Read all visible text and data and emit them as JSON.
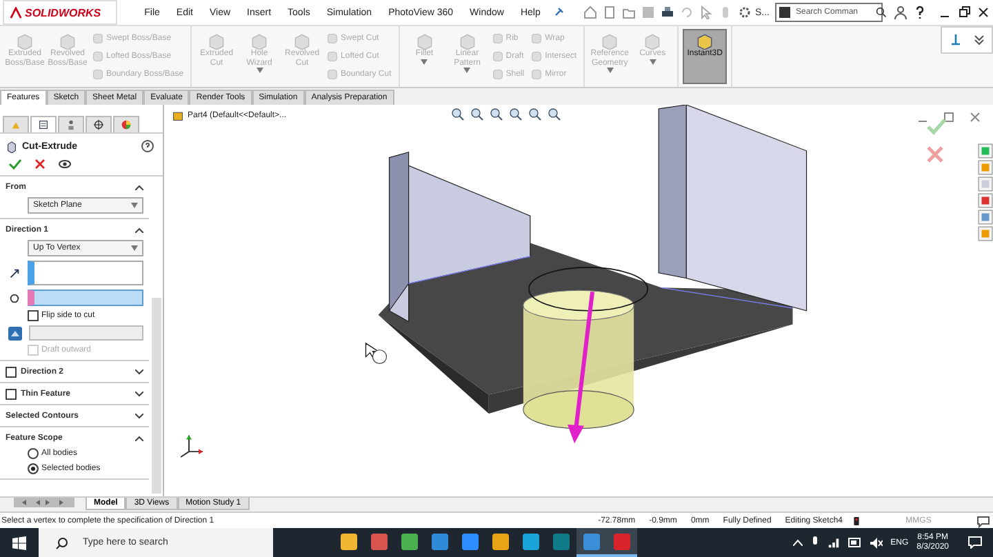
{
  "app": {
    "logo": "SOLIDWORKS",
    "menus": [
      "File",
      "Edit",
      "View",
      "Insert",
      "Tools",
      "Simulation",
      "PhotoView 360",
      "Window",
      "Help"
    ],
    "more": "S...",
    "search": {
      "placeholder": "Search Comman"
    }
  },
  "ribbon": {
    "groups": [
      {
        "items": [
          {
            "kind": "large",
            "label": "Extruded Boss/Base",
            "disabled": true,
            "selected": false,
            "menu": false
          },
          {
            "kind": "large",
            "label": "Revolved Boss/Base",
            "disabled": true,
            "selected": false,
            "menu": false
          },
          {
            "kind": "small",
            "label": "Swept Boss/Base",
            "disabled": true
          },
          {
            "kind": "small",
            "label": "Lofted Boss/Base",
            "disabled": true
          },
          {
            "kind": "small",
            "label": "Boundary Boss/Base",
            "disabled": true
          }
        ]
      },
      {
        "items": [
          {
            "kind": "large",
            "label": "Extruded Cut",
            "disabled": true,
            "selected": false,
            "menu": false
          },
          {
            "kind": "large",
            "label": "Hole Wizard",
            "disabled": true,
            "selected": false,
            "menu": true
          },
          {
            "kind": "large",
            "label": "Revolved Cut",
            "disabled": true,
            "selected": false,
            "menu": false
          },
          {
            "kind": "small",
            "label": "Swept Cut",
            "disabled": true
          },
          {
            "kind": "small",
            "label": "Lofted Cut",
            "disabled": true
          },
          {
            "kind": "small",
            "label": "Boundary Cut",
            "disabled": true
          }
        ]
      },
      {
        "items": [
          {
            "kind": "large",
            "label": "Fillet",
            "disabled": true,
            "selected": false,
            "menu": true
          },
          {
            "kind": "large",
            "label": "Linear Pattern",
            "disabled": true,
            "selected": false,
            "menu": true
          },
          {
            "kind": "small",
            "label": "Rib",
            "disabled": true
          },
          {
            "kind": "small",
            "label": "Draft",
            "disabled": true
          },
          {
            "kind": "small",
            "label": "Shell",
            "disabled": true
          },
          {
            "kind": "small",
            "label": "Wrap",
            "disabled": true
          },
          {
            "kind": "small",
            "label": "Intersect",
            "disabled": true
          },
          {
            "kind": "small",
            "label": "Mirror",
            "disabled": true
          }
        ]
      },
      {
        "items": [
          {
            "kind": "large",
            "label": "Reference Geometry",
            "disabled": true,
            "selected": false,
            "menu": true
          },
          {
            "kind": "large",
            "label": "Curves",
            "disabled": true,
            "selected": false,
            "menu": true
          }
        ]
      },
      {
        "items": [
          {
            "kind": "large",
            "label": "Instant3D",
            "disabled": false,
            "selected": true,
            "menu": false
          }
        ]
      }
    ]
  },
  "command_tabs": [
    {
      "label": "Features",
      "selected": true
    },
    {
      "label": "Sketch",
      "selected": false
    },
    {
      "label": "Sheet Metal",
      "selected": false
    },
    {
      "label": "Evaluate",
      "selected": false
    },
    {
      "label": "Render Tools",
      "selected": false
    },
    {
      "label": "Simulation",
      "selected": false
    },
    {
      "label": "Analysis Preparation",
      "selected": false
    }
  ],
  "property_manager": {
    "tabs": [
      {
        "selected": false
      },
      {
        "selected": true
      },
      {
        "selected": false
      },
      {
        "selected": false
      },
      {
        "selected": false
      }
    ],
    "title": "Cut-Extrude",
    "sections": [
      {
        "title": "From",
        "kind": "plain",
        "expanded": true,
        "controls": [
          {
            "kind": "dropdown",
            "value": "Sketch Plane"
          }
        ]
      },
      {
        "title": "Direction 1",
        "kind": "plain",
        "expanded": true,
        "controls": [
          {
            "kind": "dropdown",
            "value": "Up To Vertex"
          },
          {
            "kind": "selection",
            "active": false
          },
          {
            "kind": "selection",
            "active": true
          },
          {
            "kind": "checkbox",
            "label": "Flip side to cut",
            "checked": false,
            "disabled": false
          },
          {
            "kind": "spinner"
          },
          {
            "kind": "checkbox",
            "label": "Draft outward",
            "checked": false,
            "disabled": true
          }
        ]
      },
      {
        "title": "Direction 2",
        "kind": "checkable",
        "checked": false,
        "expanded": false
      },
      {
        "title": "Thin Feature",
        "kind": "checkable",
        "checked": false,
        "expanded": false
      },
      {
        "title": "Selected Contours",
        "kind": "plain",
        "expanded": false
      },
      {
        "title": "Feature Scope",
        "kind": "plain",
        "expanded": true,
        "controls": [
          {
            "kind": "radio",
            "label": "All bodies",
            "selected": false
          },
          {
            "kind": "radio",
            "label": "Selected bodies",
            "selected": true
          }
        ]
      }
    ]
  },
  "viewport": {
    "tree_item": "Part4 (Default<<Default>..."
  },
  "bottom_tabs": [
    {
      "label": "Model",
      "selected": true
    },
    {
      "label": "3D Views",
      "selected": false
    },
    {
      "label": "Motion Study 1",
      "selected": false
    }
  ],
  "status_bar": {
    "message": "Select a vertex to complete the specification of Direction 1",
    "fields": [
      "-72.78mm",
      "-0.9mm",
      "0mm",
      "Fully Defined",
      "Editing Sketch4"
    ],
    "units": "MMGS"
  },
  "taskbar": {
    "search": {
      "placeholder": "Type here to search"
    },
    "apps": [
      {
        "color": "#f2b632",
        "active": false
      },
      {
        "color": "#d9534f",
        "active": false
      },
      {
        "color": "#4caf50",
        "active": false
      },
      {
        "color": "#2f8ad8",
        "active": false
      },
      {
        "color": "#2d8cff",
        "active": false
      },
      {
        "color": "#e8a317",
        "active": false
      },
      {
        "color": "#1aa3d9",
        "active": false
      },
      {
        "color": "#107c8a",
        "active": false
      },
      {
        "color": "#3b8fd9",
        "active": true
      },
      {
        "color": "#d8232a",
        "active": true
      }
    ],
    "language": "ENG",
    "time": "8:54 PM",
    "date": "8/3/2020"
  }
}
